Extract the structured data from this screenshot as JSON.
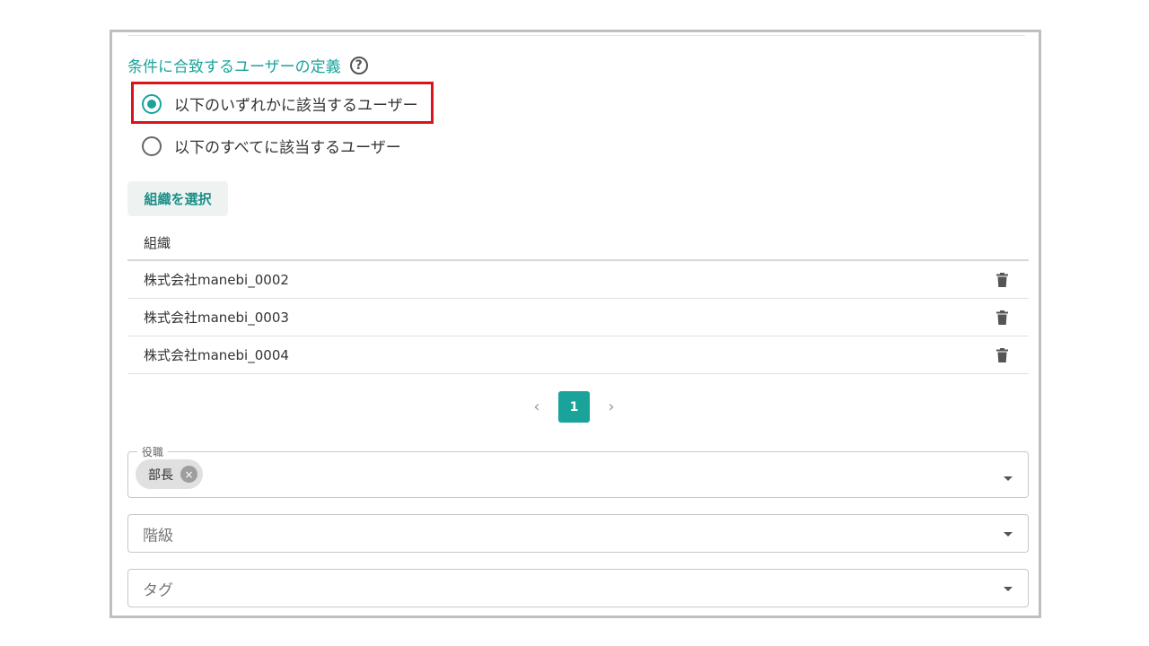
{
  "section": {
    "title": "条件に合致するユーザーの定義",
    "help_icon": "?"
  },
  "match_mode": {
    "options": [
      {
        "label": "以下のいずれかに該当するユーザー",
        "selected": true
      },
      {
        "label": "以下のすべてに該当するユーザー",
        "selected": false
      }
    ]
  },
  "org_select": {
    "button_label": "組織を選択"
  },
  "org_table": {
    "header": "組織",
    "rows": [
      {
        "name": "株式会社manebi_0002"
      },
      {
        "name": "株式会社manebi_0003"
      },
      {
        "name": "株式会社manebi_0004"
      }
    ]
  },
  "pagination": {
    "prev": "‹",
    "current_page": "1",
    "next": "›"
  },
  "filters": {
    "role": {
      "legend": "役職",
      "chips": [
        "部長"
      ],
      "chip_remove_icon": "×"
    },
    "grade": {
      "placeholder": "階級"
    },
    "tag": {
      "placeholder": "タグ"
    }
  },
  "colors": {
    "accent": "#1aa39a",
    "highlight": "#d9141b",
    "frame_border": "#bfbfbf"
  }
}
